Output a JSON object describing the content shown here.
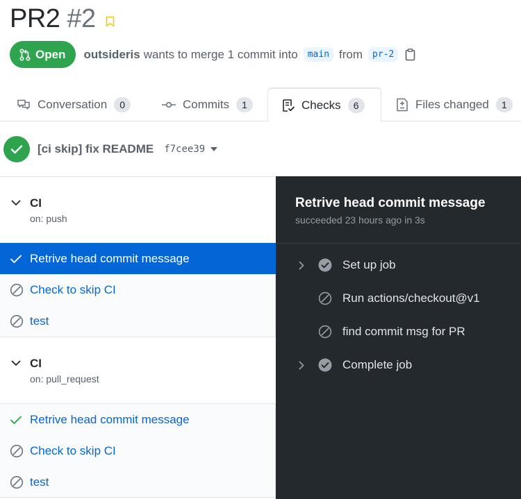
{
  "pr": {
    "title": "PR2",
    "number": "#2",
    "state": "Open",
    "author": "outsideris",
    "merge_text": "wants to merge 1 commit into",
    "base_branch": "main",
    "from_text": "from",
    "head_branch": "pr-2"
  },
  "tabs": [
    {
      "label": "Conversation",
      "count": "0",
      "icon": "comment-icon"
    },
    {
      "label": "Commits",
      "count": "1",
      "icon": "commit-icon"
    },
    {
      "label": "Checks",
      "count": "6",
      "icon": "checklist-icon",
      "selected": true
    },
    {
      "label": "Files changed",
      "count": "1",
      "icon": "file-diff-icon"
    }
  ],
  "commit": {
    "message": "[ci skip] fix README",
    "sha": "f7cee39",
    "status": "success"
  },
  "workflows": [
    {
      "name": "CI",
      "trigger": "on: push",
      "jobs": [
        {
          "label": "Retrive head commit message",
          "status": "success",
          "active": true
        },
        {
          "label": "Check to skip CI",
          "status": "skipped"
        },
        {
          "label": "test",
          "status": "skipped"
        }
      ]
    },
    {
      "name": "CI",
      "trigger": "on: pull_request",
      "jobs": [
        {
          "label": "Retrive head commit message",
          "status": "success"
        },
        {
          "label": "Check to skip CI",
          "status": "skipped"
        },
        {
          "label": "test",
          "status": "skipped"
        }
      ]
    }
  ],
  "log": {
    "title": "Retrive head commit message",
    "status": "succeeded 23 hours ago in 3s",
    "steps": [
      {
        "label": "Set up job",
        "status": "success",
        "expandable": true
      },
      {
        "label": "Run actions/checkout@v1",
        "status": "skipped",
        "expandable": false
      },
      {
        "label": "find commit msg for PR",
        "status": "skipped",
        "expandable": false
      },
      {
        "label": "Complete job",
        "status": "success",
        "expandable": true
      }
    ]
  },
  "colors": {
    "open_green": "#2ea44f",
    "link_blue": "#0366d6",
    "log_background": "#24292e"
  }
}
